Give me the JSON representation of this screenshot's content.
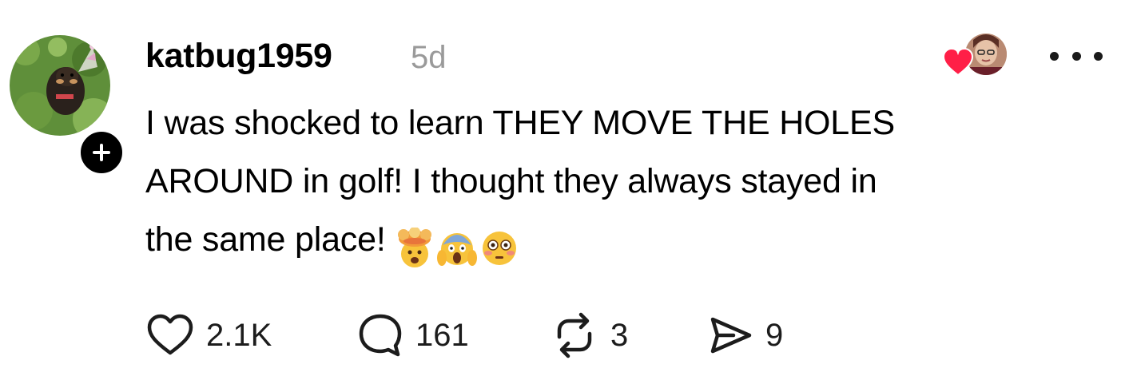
{
  "post": {
    "username": "katbug1959",
    "timestamp": "5d",
    "text_line1": "I was shocked to learn THEY MOVE THE HOLES",
    "text_line2": "AROUND in golf! I thought they always stayed in",
    "text_line3": "the same place!",
    "emojis": [
      "exploding-head",
      "face-screaming-in-fear",
      "flushed-face"
    ]
  },
  "actions": {
    "likes": "2.1K",
    "replies": "161",
    "reposts": "3",
    "shares": "9"
  },
  "icons": {
    "like": "heart-outline-icon",
    "reply": "speech-bubble-icon",
    "repost": "repost-arrows-icon",
    "share": "paper-plane-icon",
    "more": "more-dots-icon",
    "follow": "plus-icon",
    "liked_by": "red-heart-icon"
  },
  "colors": {
    "text": "#000000",
    "muted": "#9a9a9a",
    "heart_red": "#ff1f47",
    "badge": "#000000"
  }
}
